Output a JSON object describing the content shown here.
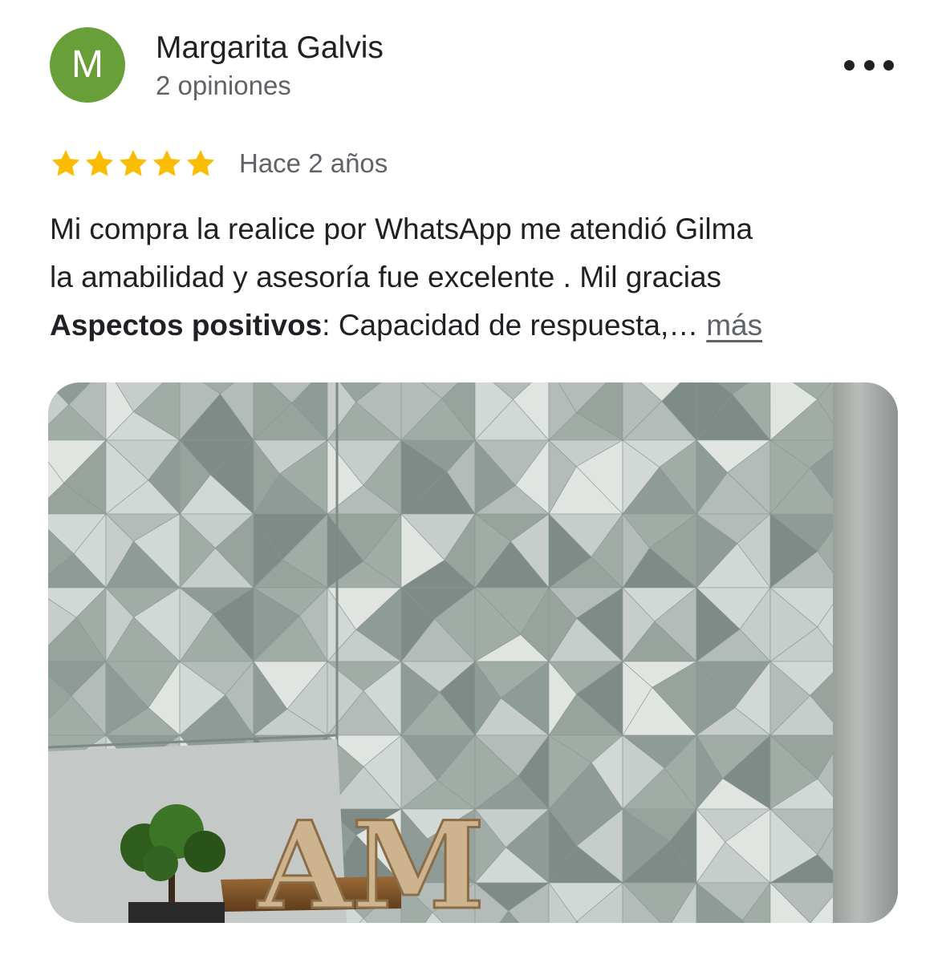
{
  "review": {
    "author": {
      "initial": "M",
      "name": "Margarita Galvis",
      "review_count": "2 opiniones",
      "avatar_color": "#689f38"
    },
    "rating": 5,
    "rating_max": 5,
    "star_color": "#fbbc04",
    "date": "Hace 2 años",
    "text_line1": "Mi compra la realice por WhatsApp me atendió Gilma",
    "text_line2": "la amabilidad y asesoría fue excelente . Mil gracias",
    "highlights_label": "Aspectos positivos",
    "highlights_separator": ": ",
    "highlights_value": "Capacidad de respuesta,…",
    "more_label": "más",
    "menu_icon": "more-horizontal-icon",
    "photo_monogram": "AM"
  }
}
